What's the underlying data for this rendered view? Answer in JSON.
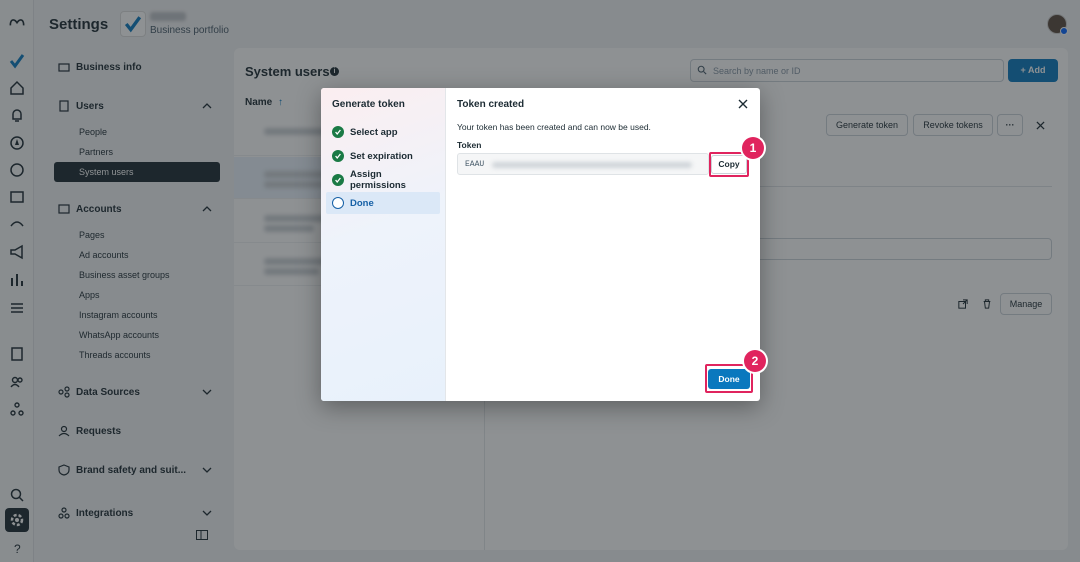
{
  "topbar": {
    "title": "Settings",
    "portfolio_label": "Business portfolio"
  },
  "sidenav": {
    "business_info": "Business info",
    "users_section": "Users",
    "users_items": [
      "People",
      "Partners",
      "System users"
    ],
    "accounts_section": "Accounts",
    "accounts_items": [
      "Pages",
      "Ad accounts",
      "Business asset groups",
      "Apps",
      "Instagram accounts",
      "WhatsApp accounts",
      "Threads accounts"
    ],
    "data_sources": "Data Sources",
    "requests": "Requests",
    "brand_safety": "Brand safety and suit...",
    "integrations": "Integrations"
  },
  "main": {
    "title": "System users",
    "search_placeholder": "Search by name or ID",
    "add_label": "+ Add",
    "col_name": "Name",
    "generate_token": "Generate token",
    "revoke_tokens": "Revoke tokens",
    "more": "···",
    "manage": "Manage"
  },
  "modal": {
    "left_title": "Generate token",
    "steps": [
      {
        "label": "Select app",
        "status": "done"
      },
      {
        "label": "Set expiration",
        "status": "done"
      },
      {
        "label": "Assign permissions",
        "status": "done"
      },
      {
        "label": "Done",
        "status": "current"
      }
    ],
    "title": "Token created",
    "description": "Your token has been created and can now be used.",
    "token_label": "Token",
    "token_prefix": "EAAU",
    "copy_label": "Copy",
    "done_label": "Done"
  },
  "annotations": {
    "step1": "1",
    "step2": "2",
    "highlight_color": "#e0245e"
  },
  "colors": {
    "primary": "#0a78be",
    "success": "#1a7a45",
    "nav_selected": "#1c2b33"
  }
}
